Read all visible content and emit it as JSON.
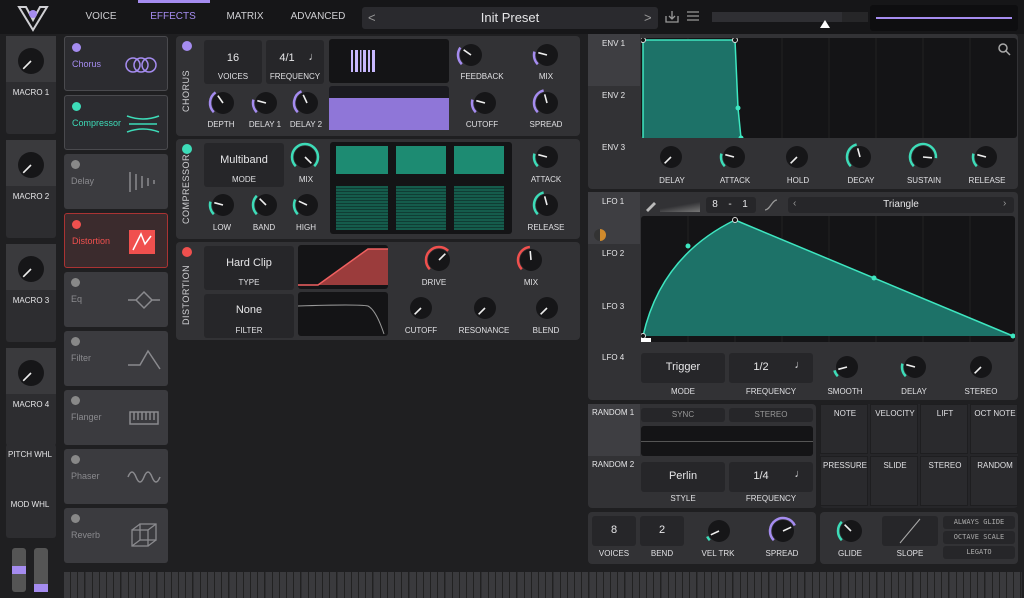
{
  "tabs": [
    "VOICE",
    "EFFECTS",
    "MATRIX",
    "ADVANCED"
  ],
  "preset": {
    "name": "Init Preset",
    "prev": "<",
    "next": ">"
  },
  "macros": [
    "MACRO 1",
    "MACRO 2",
    "MACRO 3",
    "MACRO 4"
  ],
  "wheels": [
    "PITCH WHL",
    "MOD WHL"
  ],
  "fx_list": [
    {
      "name": "Chorus",
      "on": true,
      "color": "#a58cf0"
    },
    {
      "name": "Compressor",
      "on": true,
      "color": "#3ddcb8"
    },
    {
      "name": "Delay",
      "on": false,
      "color": "#888"
    },
    {
      "name": "Distortion",
      "on": true,
      "color": "#f0504e"
    },
    {
      "name": "Eq",
      "on": false,
      "color": "#888"
    },
    {
      "name": "Filter",
      "on": false,
      "color": "#888"
    },
    {
      "name": "Flanger",
      "on": false,
      "color": "#888"
    },
    {
      "name": "Phaser",
      "on": false,
      "color": "#888"
    },
    {
      "name": "Reverb",
      "on": false,
      "color": "#888"
    }
  ],
  "chorus": {
    "title": "CHORUS",
    "voices": "16",
    "voices_lbl": "VOICES",
    "freq": "4/1",
    "freq_lbl": "FREQUENCY",
    "feedback": "FEEDBACK",
    "mix": "MIX",
    "depth": "DEPTH",
    "delay1": "DELAY 1",
    "delay2": "DELAY 2",
    "cutoff": "CUTOFF",
    "spread": "SPREAD"
  },
  "compressor": {
    "title": "COMPRESSOR",
    "mode": "Multiband",
    "mode_lbl": "MODE",
    "mix": "MIX",
    "attack": "ATTACK",
    "low": "LOW",
    "band": "BAND",
    "high": "HIGH",
    "release": "RELEASE"
  },
  "distortion": {
    "title": "DISTORTION",
    "type": "Hard Clip",
    "type_lbl": "TYPE",
    "drive": "DRIVE",
    "mix": "MIX",
    "filter": "None",
    "filter_lbl": "FILTER",
    "cutoff": "CUTOFF",
    "resonance": "RESONANCE",
    "blend": "BLEND"
  },
  "env": {
    "tabs": [
      "ENV 1",
      "ENV 2",
      "ENV 3"
    ],
    "knobs": [
      "DELAY",
      "ATTACK",
      "HOLD",
      "DECAY",
      "SUSTAIN",
      "RELEASE"
    ]
  },
  "lfo": {
    "tabs": [
      "LFO 1",
      "LFO 2",
      "LFO 3",
      "LFO 4"
    ],
    "rate": "8",
    "sep": "-",
    "rate2": "1",
    "shape": "Triangle",
    "mode": "Trigger",
    "mode_lbl": "MODE",
    "freq": "1/2",
    "freq_lbl": "FREQUENCY",
    "smooth": "SMOOTH",
    "delay": "DELAY",
    "stereo": "STEREO"
  },
  "random": {
    "tabs": [
      "RANDOM 1",
      "RANDOM 2"
    ],
    "sync": "SYNC",
    "stereo": "STEREO",
    "style": "Perlin",
    "style_lbl": "STYLE",
    "freq": "1/4",
    "freq_lbl": "FREQUENCY"
  },
  "mods": [
    "NOTE",
    "VELOCITY",
    "LIFT",
    "OCT NOTE",
    "PRESSURE",
    "SLIDE",
    "STEREO",
    "RANDOM"
  ],
  "voice": {
    "voices": "8",
    "voices_lbl": "VOICES",
    "bend": "2",
    "bend_lbl": "BEND",
    "veltrk": "VEL TRK",
    "spread": "SPREAD"
  },
  "glide": {
    "glide": "GLIDE",
    "slope": "SLOPE",
    "opts": [
      "ALWAYS GLIDE",
      "OCTAVE SCALE",
      "LEGATO"
    ]
  }
}
